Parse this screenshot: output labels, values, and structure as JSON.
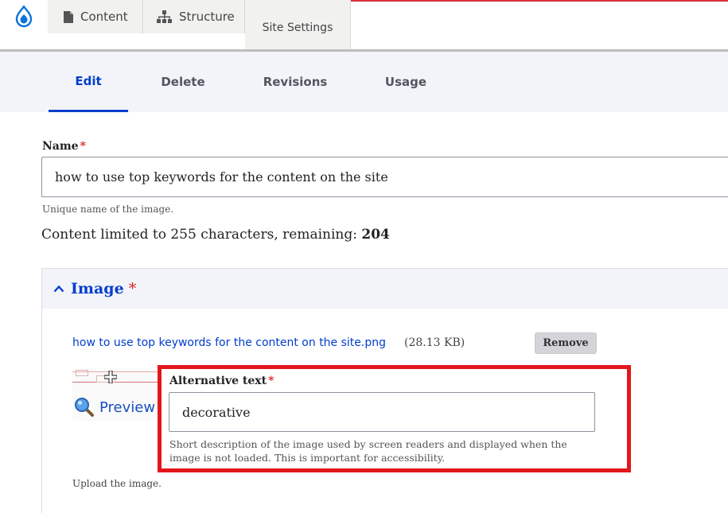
{
  "toolbar": {
    "logo_icon": "drupal-drop-icon",
    "content_label": "Content",
    "content_icon": "file-icon",
    "structure_label": "Structure",
    "structure_icon": "sitemap-icon",
    "site_settings_label": "Site Settings"
  },
  "tabs": [
    {
      "label": "Edit",
      "active": true
    },
    {
      "label": "Delete",
      "active": false
    },
    {
      "label": "Revisions",
      "active": false
    },
    {
      "label": "Usage",
      "active": false
    }
  ],
  "form": {
    "name_label": "Name",
    "required_mark": "*",
    "name_value": "how to use top keywords for the content on the site",
    "name_description": "Unique name of the image.",
    "counter_text": "Content limited to 255 characters, remaining: ",
    "counter_remaining": "204"
  },
  "image_section": {
    "title": "Image",
    "required_mark": "*",
    "file_name": "how to use top keywords for the content on the site.png",
    "file_size": "(28.13 KB)",
    "remove_label": "Remove",
    "preview_label": "Preview",
    "alt_label": "Alternative text",
    "alt_value": "decorative",
    "alt_description": "Short description of the image used by screen readers and displayed when the image is not loaded. This is important for accessibility.",
    "upload_description": "Upload the image."
  },
  "colors": {
    "accent": "#003ecc",
    "required": "#dc2323",
    "highlight": "#e3161c"
  }
}
